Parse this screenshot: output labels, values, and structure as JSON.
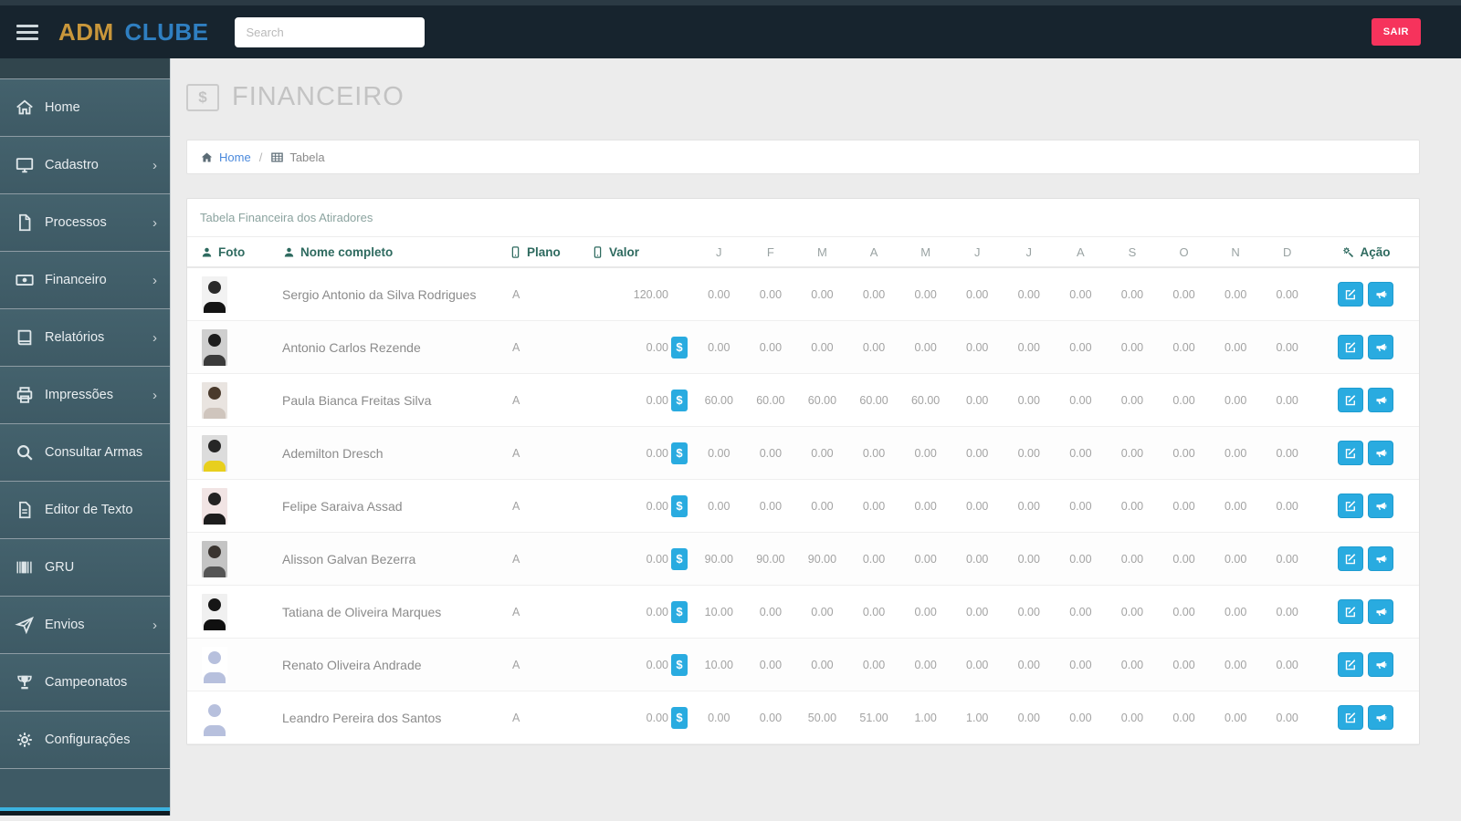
{
  "topbar": {
    "brand_adm": "ADM",
    "brand_clube": "CLUBE",
    "search_placeholder": "Search",
    "logout_label": "SAIR"
  },
  "sidebar": {
    "items": [
      {
        "id": "home",
        "label": "Home",
        "icon": "home",
        "has_submenu": false
      },
      {
        "id": "cadastro",
        "label": "Cadastro",
        "icon": "desktop",
        "has_submenu": true
      },
      {
        "id": "processos",
        "label": "Processos",
        "icon": "file",
        "has_submenu": true
      },
      {
        "id": "financeiro",
        "label": "Financeiro",
        "icon": "money",
        "has_submenu": true
      },
      {
        "id": "relatorios",
        "label": "Relatórios",
        "icon": "book",
        "has_submenu": true
      },
      {
        "id": "impressoes",
        "label": "Impressões",
        "icon": "print",
        "has_submenu": true
      },
      {
        "id": "consultar-armas",
        "label": "Consultar Armas",
        "icon": "search",
        "has_submenu": false
      },
      {
        "id": "editor-de-texto",
        "label": "Editor de Texto",
        "icon": "filetext",
        "has_submenu": false
      },
      {
        "id": "gru",
        "label": "GRU",
        "icon": "barcode",
        "has_submenu": false
      },
      {
        "id": "envios",
        "label": "Envios",
        "icon": "send",
        "has_submenu": true
      },
      {
        "id": "campeonatos",
        "label": "Campeonatos",
        "icon": "trophy",
        "has_submenu": false
      },
      {
        "id": "configuracoes",
        "label": "Configurações",
        "icon": "gear",
        "has_submenu": false
      }
    ]
  },
  "page": {
    "title": "FINANCEIRO",
    "title_icon_char": "$"
  },
  "breadcrumb": {
    "home_label": "Home",
    "separator": "/",
    "current_label": "Tabela"
  },
  "panel": {
    "title": "Tabela Financeira dos Atiradores"
  },
  "table": {
    "headers": [
      {
        "id": "foto",
        "label": "Foto",
        "icon": "user"
      },
      {
        "id": "nome",
        "label": "Nome completo",
        "icon": "user"
      },
      {
        "id": "plano",
        "label": "Plano",
        "icon": "mobile"
      },
      {
        "id": "valor",
        "label": "Valor",
        "icon": "mobile"
      },
      {
        "id": "acao",
        "label": "Ação",
        "icon": "tools"
      }
    ],
    "months": [
      "J",
      "F",
      "M",
      "A",
      "M",
      "J",
      "J",
      "A",
      "S",
      "O",
      "N",
      "D"
    ],
    "dollar_badge_char": "$",
    "actions": [
      {
        "id": "edit",
        "icon": "edit"
      },
      {
        "id": "announce",
        "icon": "megaphone"
      }
    ],
    "rows": [
      {
        "name": "Sergio Antonio da Silva Rodrigues",
        "plano": "A",
        "valor": "120.00",
        "dollar_badge": false,
        "months": [
          "0.00",
          "0.00",
          "0.00",
          "0.00",
          "0.00",
          "0.00",
          "0.00",
          "0.00",
          "0.00",
          "0.00",
          "0.00",
          "0.00"
        ],
        "avatar": {
          "type": "photo",
          "bg": "#f2f2f2",
          "head": "#2a2a2a",
          "shirt": "#141414"
        }
      },
      {
        "name": "Antonio Carlos Rezende",
        "plano": "A",
        "valor": "0.00",
        "dollar_badge": true,
        "months": [
          "0.00",
          "0.00",
          "0.00",
          "0.00",
          "0.00",
          "0.00",
          "0.00",
          "0.00",
          "0.00",
          "0.00",
          "0.00",
          "0.00"
        ],
        "avatar": {
          "type": "photo",
          "bg": "#cfcfcf",
          "head": "#1d1d1d",
          "shirt": "#3a3a3a"
        }
      },
      {
        "name": "Paula Bianca Freitas Silva",
        "plano": "A",
        "valor": "0.00",
        "dollar_badge": true,
        "months": [
          "60.00",
          "60.00",
          "60.00",
          "60.00",
          "60.00",
          "0.00",
          "0.00",
          "0.00",
          "0.00",
          "0.00",
          "0.00",
          "0.00"
        ],
        "avatar": {
          "type": "photo",
          "bg": "#e9e4e0",
          "head": "#4a3a2c",
          "shirt": "#cfc5bd"
        }
      },
      {
        "name": "Ademilton Dresch",
        "plano": "A",
        "valor": "0.00",
        "dollar_badge": true,
        "months": [
          "0.00",
          "0.00",
          "0.00",
          "0.00",
          "0.00",
          "0.00",
          "0.00",
          "0.00",
          "0.00",
          "0.00",
          "0.00",
          "0.00"
        ],
        "avatar": {
          "type": "photo",
          "bg": "#dcdcdc",
          "head": "#262626",
          "shirt": "#e8cf1e"
        }
      },
      {
        "name": "Felipe Saraiva Assad",
        "plano": "A",
        "valor": "0.00",
        "dollar_badge": true,
        "months": [
          "0.00",
          "0.00",
          "0.00",
          "0.00",
          "0.00",
          "0.00",
          "0.00",
          "0.00",
          "0.00",
          "0.00",
          "0.00",
          "0.00"
        ],
        "avatar": {
          "type": "photo",
          "bg": "#f1e4e4",
          "head": "#222222",
          "shirt": "#1d1d1d"
        }
      },
      {
        "name": "Alisson Galvan Bezerra",
        "plano": "A",
        "valor": "0.00",
        "dollar_badge": true,
        "months": [
          "90.00",
          "90.00",
          "90.00",
          "0.00",
          "0.00",
          "0.00",
          "0.00",
          "0.00",
          "0.00",
          "0.00",
          "0.00",
          "0.00"
        ],
        "avatar": {
          "type": "photo",
          "bg": "#c4c4c4",
          "head": "#3a3430",
          "shirt": "#555555"
        }
      },
      {
        "name": "Tatiana de Oliveira Marques",
        "plano": "A",
        "valor": "0.00",
        "dollar_badge": true,
        "months": [
          "10.00",
          "0.00",
          "0.00",
          "0.00",
          "0.00",
          "0.00",
          "0.00",
          "0.00",
          "0.00",
          "0.00",
          "0.00",
          "0.00"
        ],
        "avatar": {
          "type": "photo",
          "bg": "#f0f0f0",
          "head": "#161616",
          "shirt": "#101010"
        }
      },
      {
        "name": "Renato Oliveira Andrade",
        "plano": "A",
        "valor": "0.00",
        "dollar_badge": true,
        "months": [
          "10.00",
          "0.00",
          "0.00",
          "0.00",
          "0.00",
          "0.00",
          "0.00",
          "0.00",
          "0.00",
          "0.00",
          "0.00",
          "0.00"
        ],
        "avatar": {
          "type": "placeholder",
          "bg": "#ffffff",
          "head": "#b7c0dd",
          "shirt": "#b7c0dd"
        }
      },
      {
        "name": "Leandro Pereira dos Santos",
        "plano": "A",
        "valor": "0.00",
        "dollar_badge": true,
        "months": [
          "0.00",
          "0.00",
          "50.00",
          "51.00",
          "1.00",
          "1.00",
          "0.00",
          "0.00",
          "0.00",
          "0.00",
          "0.00",
          "0.00"
        ],
        "avatar": {
          "type": "placeholder",
          "bg": "#ffffff",
          "head": "#b7c0dd",
          "shirt": "#b7c0dd"
        }
      }
    ]
  },
  "colors": {
    "topbar_bg": "#17242e",
    "sidebar_bg": "#405d68",
    "accent_blue": "#29abe0",
    "teal_header": "#2e6a5f",
    "logout_red": "#f6335c",
    "brand_gold": "#c9973b",
    "brand_blue": "#2f7fc1",
    "link_blue": "#4a89dc"
  }
}
